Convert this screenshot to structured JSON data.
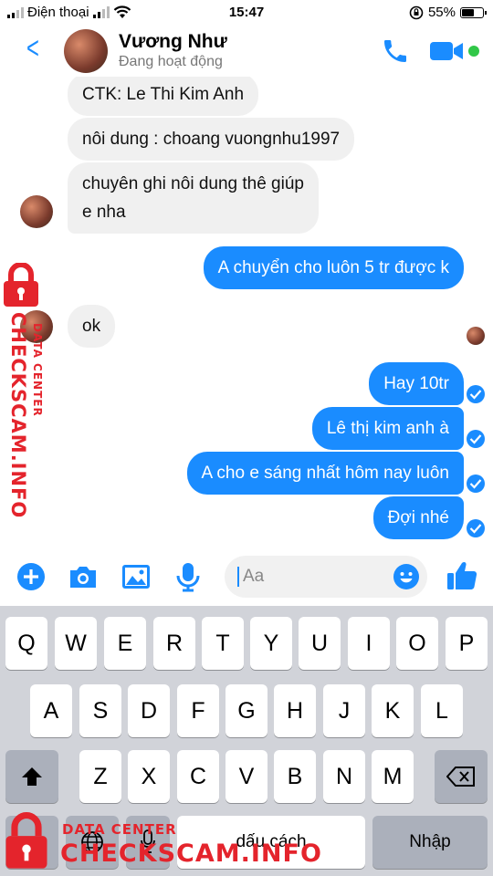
{
  "status_bar": {
    "carrier": "Điện thoại",
    "time": "15:47",
    "battery": "55%"
  },
  "header": {
    "contact_name": "Vương Như",
    "presence": "Đang hoạt động"
  },
  "messages": [
    {
      "direction": "in",
      "text": "CTK: Le Thi Kim Anh"
    },
    {
      "direction": "in",
      "text": "nôi dung : choang vuongnhu1997"
    },
    {
      "direction": "in",
      "text_line1": "chuyên ghi nôi dung thê giúp",
      "text_line2": "e nha"
    },
    {
      "direction": "out",
      "text": "A chuyển cho luôn 5 tr được k"
    },
    {
      "direction": "in",
      "text": "ok"
    },
    {
      "direction": "out",
      "text": "Hay 10tr"
    },
    {
      "direction": "out",
      "text": "Lê thị kim anh à"
    },
    {
      "direction": "out",
      "text": "A cho e sáng nhất hôm nay luôn"
    },
    {
      "direction": "out",
      "text": "Đợi nhé"
    }
  ],
  "composer": {
    "placeholder": "Aa"
  },
  "keyboard": {
    "row1": [
      "Q",
      "W",
      "E",
      "R",
      "T",
      "Y",
      "U",
      "I",
      "O",
      "P"
    ],
    "row2": [
      "A",
      "S",
      "D",
      "F",
      "G",
      "H",
      "J",
      "K",
      "L"
    ],
    "row3": [
      "Z",
      "X",
      "C",
      "V",
      "B",
      "N",
      "M"
    ],
    "space_label": "dấu cách",
    "return_label": "Nhập"
  },
  "watermark": {
    "side_small": "DATA CENTER",
    "side_large": "CHECKSCAM.INFO",
    "bottom_small": "DATA CENTER",
    "bottom_large": "CHECKSCAM.INFO"
  },
  "colors": {
    "accent": "#1a8cff",
    "online": "#31c748",
    "watermark": "#e4242c"
  }
}
